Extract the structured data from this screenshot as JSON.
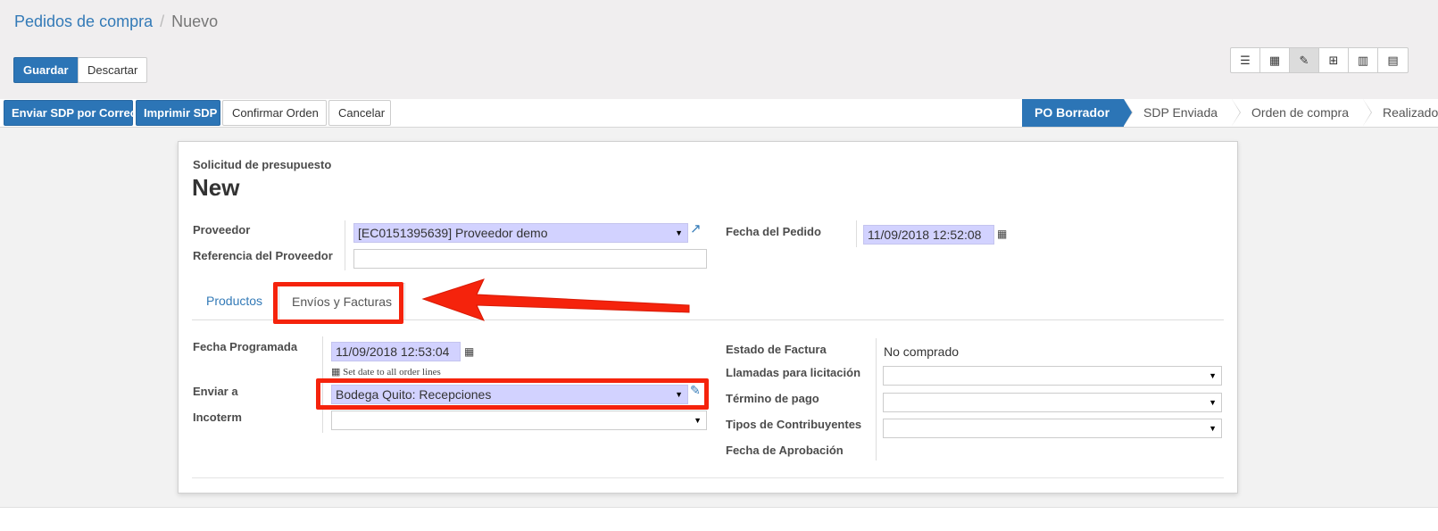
{
  "breadcrumb": {
    "parent": "Pedidos de compra",
    "separator": "/",
    "current": "Nuevo"
  },
  "toolbar": {
    "save_label": "Guardar",
    "discard_label": "Descartar"
  },
  "view_switcher": {
    "views": [
      {
        "name": "list",
        "icon": "☰"
      },
      {
        "name": "kanban",
        "icon": "▦"
      },
      {
        "name": "form",
        "icon": "✎"
      },
      {
        "name": "pivot",
        "icon": "⊞"
      },
      {
        "name": "graph",
        "icon": "▥"
      },
      {
        "name": "calendar",
        "icon": "▤"
      }
    ]
  },
  "actions": {
    "send_email": "Enviar SDP por Correo",
    "print": "Imprimir SDP",
    "confirm": "Confirmar Orden",
    "cancel": "Cancelar"
  },
  "stages": [
    "PO Borrador",
    "SDP Enviada",
    "Orden de compra",
    "Realizado"
  ],
  "form": {
    "doc_type": "Solicitud de presupuesto",
    "name": "New",
    "vendor_label": "Proveedor",
    "vendor_value": "[EC0151395639] Proveedor demo",
    "vendor_ref_label": "Referencia del Proveedor",
    "vendor_ref_value": "",
    "order_date_label": "Fecha del Pedido",
    "order_date_value": "11/09/2018 12:52:08"
  },
  "tabs": [
    "Productos",
    "Envíos y Facturas"
  ],
  "shipping": {
    "scheduled_label": "Fecha Programada",
    "scheduled_value": "11/09/2018 12:53:04",
    "set_date_link": "Set date to all order lines",
    "ship_to_label": "Enviar a",
    "ship_to_value": "Bodega Quito: Recepciones",
    "incoterm_label": "Incoterm",
    "incoterm_value": ""
  },
  "billing": {
    "invoice_status_label": "Estado de Factura",
    "invoice_status_value": "No comprado",
    "bid_calls_label": "Llamadas para licitación",
    "payment_term_label": "Término de pago",
    "taxpayer_types_label": "Tipos de Contribuyentes",
    "approval_date_label": "Fecha de Aprobación"
  },
  "colors": {
    "primary": "#2c75b6",
    "required_field": "#d2d2ff",
    "annotation": "#f5230c"
  }
}
